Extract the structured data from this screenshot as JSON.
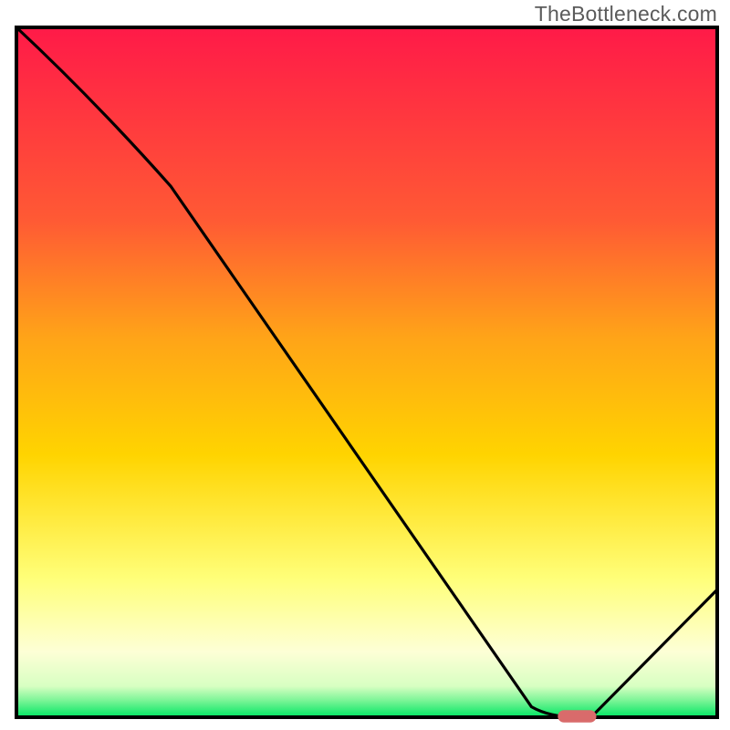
{
  "watermark": "TheBottleneck.com",
  "colors": {
    "border": "#000000",
    "curve": "#000000",
    "marker_fill": "#d96b6b",
    "grad_top": "#ff1a48",
    "grad_mid_upper": "#ff7a2a",
    "grad_mid": "#ffd400",
    "grad_mid_lower": "#ffff66",
    "grad_pale": "#fdffd6",
    "grad_green": "#00e663"
  },
  "chart_data": {
    "type": "line",
    "title": "",
    "xlabel": "",
    "ylabel": "",
    "x": [
      0.0,
      0.22,
      0.735,
      0.8,
      0.82,
      1.0
    ],
    "values": [
      1.0,
      0.77,
      0.015,
      0.0,
      0.0,
      0.185
    ],
    "xlim": [
      0,
      1
    ],
    "ylim": [
      0,
      1
    ],
    "marker": {
      "x": 0.8,
      "y": 0.0,
      "width_frac": 0.055,
      "height_frac": 0.018
    },
    "background_gradient_stops": [
      {
        "offset": 0.0,
        "hint": "red-pink"
      },
      {
        "offset": 0.3,
        "hint": "orange"
      },
      {
        "offset": 0.55,
        "hint": "yellow"
      },
      {
        "offset": 0.8,
        "hint": "pale-yellow"
      },
      {
        "offset": 0.97,
        "hint": "white-green-mix"
      },
      {
        "offset": 1.0,
        "hint": "green"
      }
    ]
  }
}
